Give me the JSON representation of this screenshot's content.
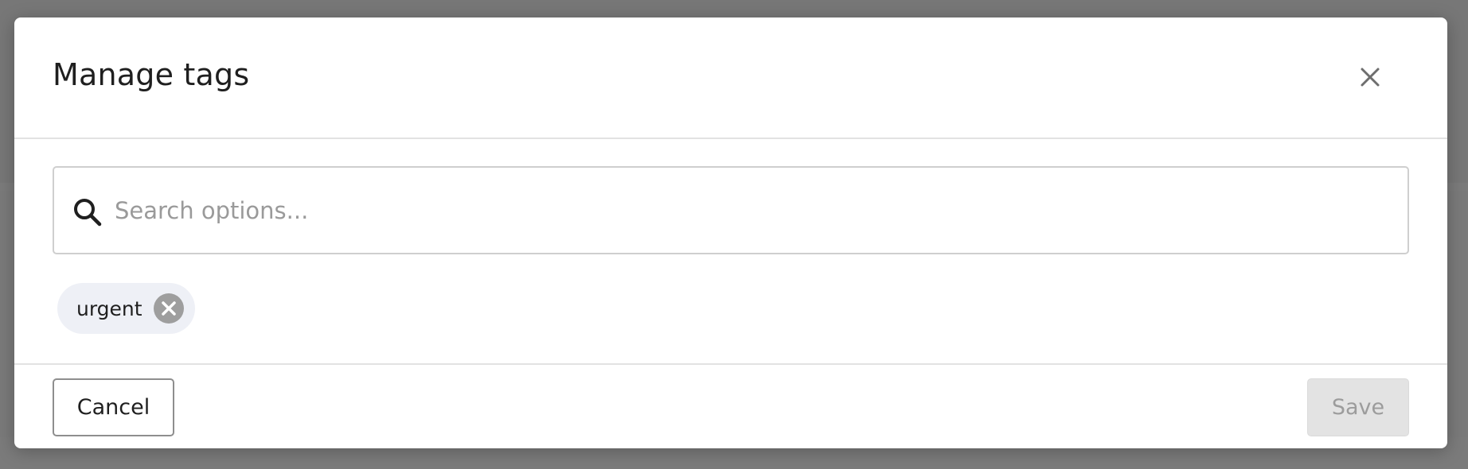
{
  "modal": {
    "title": "Manage tags"
  },
  "search": {
    "placeholder": "Search options...",
    "value": ""
  },
  "selected_tags": [
    {
      "label": "urgent"
    }
  ],
  "footer": {
    "cancel_label": "Cancel",
    "save_label": "Save",
    "save_enabled": false
  },
  "icons": {
    "close": "close-icon",
    "search": "search-icon",
    "chip_remove": "circle-x-icon"
  },
  "colors": {
    "overlay": "#7a7a7a",
    "chip_bg": "#eef0f6",
    "save_disabled_bg": "#e3e3e3",
    "save_disabled_text": "#9c9c9c"
  }
}
